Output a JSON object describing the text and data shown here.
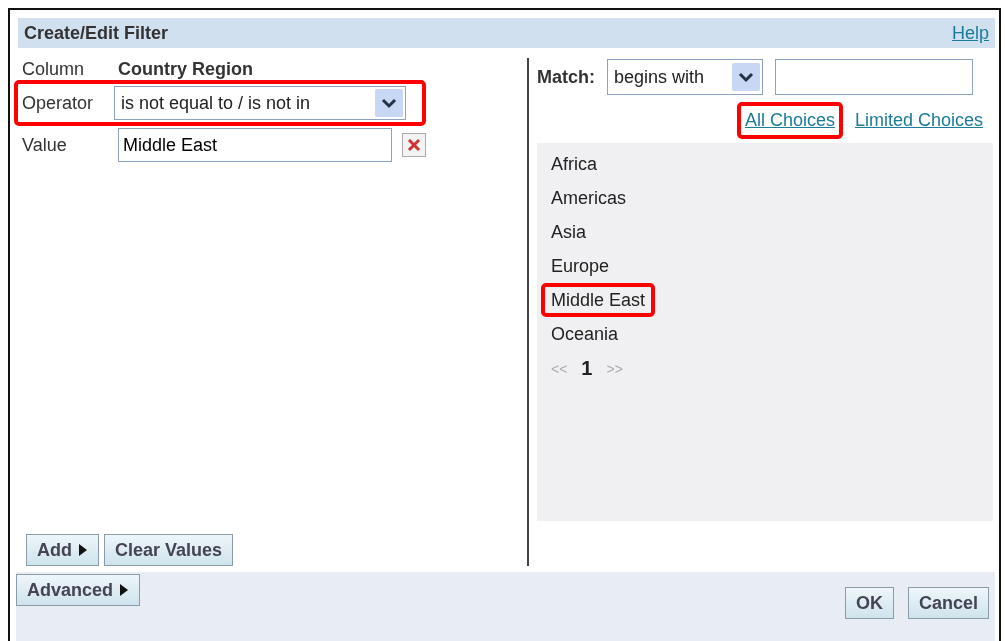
{
  "dialog": {
    "title": "Create/Edit Filter",
    "help_link": "Help"
  },
  "left": {
    "column_label": "Column",
    "column_value": "Country Region",
    "operator": {
      "label": "Operator",
      "value": "is not equal to / is not in",
      "highlighted": true
    },
    "value": {
      "label": "Value",
      "value": "Middle East"
    },
    "buttons": [
      {
        "label": "Add",
        "arrow": true
      },
      {
        "label": "Clear Values",
        "arrow": false
      }
    ]
  },
  "right": {
    "match_label": "Match:",
    "match_value": "begins with",
    "links": [
      {
        "label": "All Choices",
        "highlighted": true
      },
      {
        "label": "Limited Choices",
        "highlighted": false
      }
    ],
    "choices": [
      {
        "label": "Africa",
        "highlighted": false
      },
      {
        "label": "Americas",
        "highlighted": false
      },
      {
        "label": "Asia",
        "highlighted": false
      },
      {
        "label": "Europe",
        "highlighted": false
      },
      {
        "label": "Middle East",
        "highlighted": true
      },
      {
        "label": "Oceania",
        "highlighted": false
      }
    ],
    "pager": {
      "prev": "<<",
      "page": "1",
      "next": ">>"
    }
  },
  "footer": {
    "advanced": "Advanced",
    "buttons": [
      "OK",
      "Cancel"
    ]
  }
}
